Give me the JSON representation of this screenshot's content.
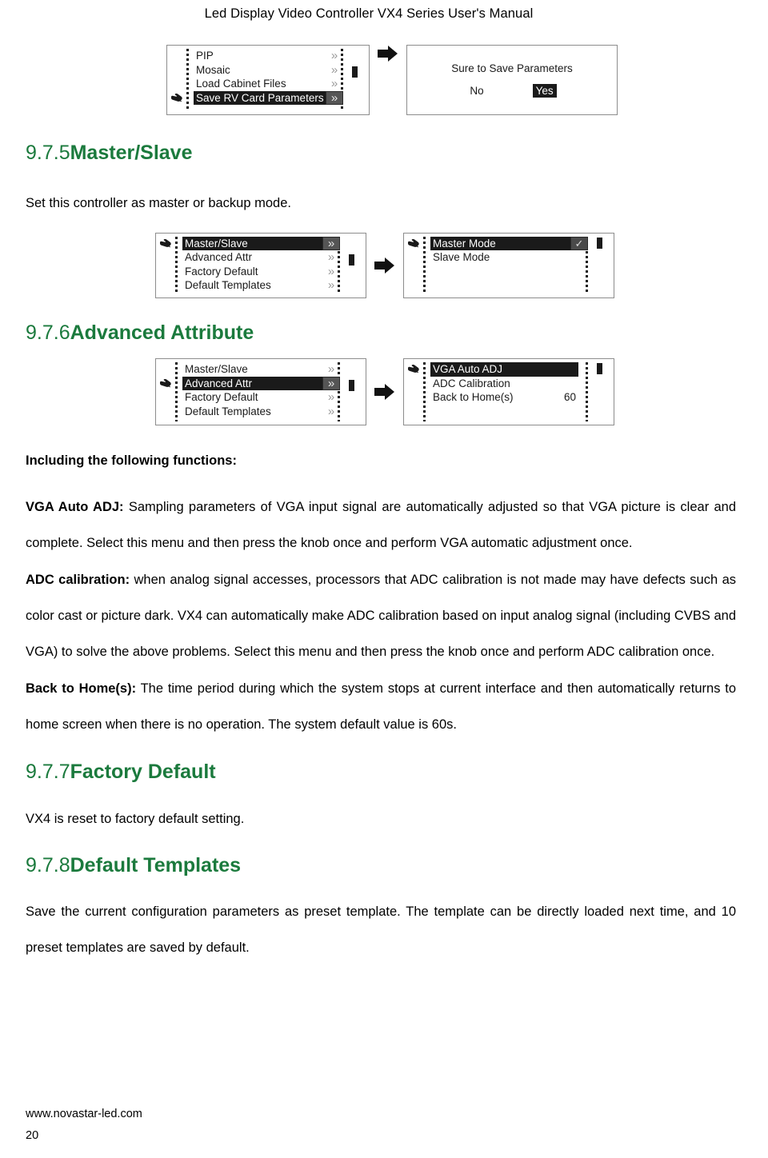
{
  "header": {
    "title": "Led Display Video Controller VX4 Series User's Manual"
  },
  "colors": {
    "heading_green": "#1b7a3d",
    "lcd_border": "#8d8d8d",
    "selected_bg": "#1a1a1a",
    "chevron_gray": "#9a9a9a"
  },
  "icons": {
    "hand": "pointing-hand-icon",
    "arrow": "right-arrow-icon",
    "chevron": "»",
    "check": "✓"
  },
  "diagrams": [
    {
      "name": "save-rv-card-parameters",
      "left_panel": {
        "rows": [
          {
            "label": "PIP",
            "chevron": "»",
            "selected": false,
            "hand": false,
            "value": ""
          },
          {
            "label": "Mosaic",
            "chevron": "»",
            "selected": false,
            "hand": false,
            "value": ""
          },
          {
            "label": "Load Cabinet Files",
            "chevron": "»",
            "selected": false,
            "hand": false,
            "value": ""
          },
          {
            "label": "Save RV Card Parameters",
            "chevron": "»",
            "selected": true,
            "hand": true,
            "value": ""
          }
        ]
      },
      "right_panel": {
        "type": "dialog",
        "message": "Sure to Save Parameters",
        "options": [
          {
            "label": "No",
            "selected": false
          },
          {
            "label": "Yes",
            "selected": true
          }
        ]
      }
    },
    {
      "name": "master-slave",
      "left_panel": {
        "rows": [
          {
            "label": "Master/Slave",
            "chevron": "»",
            "selected": true,
            "hand": true,
            "value": ""
          },
          {
            "label": "Advanced Attr",
            "chevron": "»",
            "selected": false,
            "hand": false,
            "value": ""
          },
          {
            "label": "Factory Default",
            "chevron": "»",
            "selected": false,
            "hand": false,
            "value": ""
          },
          {
            "label": "Default Templates",
            "chevron": "»",
            "selected": false,
            "hand": false,
            "value": ""
          }
        ]
      },
      "right_panel": {
        "type": "menu",
        "rows": [
          {
            "label": "Master Mode",
            "chevron": "✓",
            "selected": true,
            "hand": true,
            "value": ""
          },
          {
            "label": "Slave Mode",
            "chevron": "",
            "selected": false,
            "hand": false,
            "value": ""
          }
        ]
      }
    },
    {
      "name": "advanced-attribute",
      "left_panel": {
        "rows": [
          {
            "label": "Master/Slave",
            "chevron": "»",
            "selected": false,
            "hand": false,
            "value": ""
          },
          {
            "label": "Advanced Attr",
            "chevron": "»",
            "selected": true,
            "hand": true,
            "value": ""
          },
          {
            "label": "Factory Default",
            "chevron": "»",
            "selected": false,
            "hand": false,
            "value": ""
          },
          {
            "label": "Default Templates",
            "chevron": "»",
            "selected": false,
            "hand": false,
            "value": ""
          }
        ]
      },
      "right_panel": {
        "type": "menu",
        "rows": [
          {
            "label": "VGA Auto ADJ",
            "chevron": "",
            "selected": true,
            "hand": true,
            "value": ""
          },
          {
            "label": "ADC Calibration",
            "chevron": "",
            "selected": false,
            "hand": false,
            "value": ""
          },
          {
            "label": "Back to Home(s)",
            "chevron": "",
            "selected": false,
            "hand": false,
            "value": "60"
          }
        ]
      }
    }
  ],
  "sections": {
    "master_slave": {
      "number": "9.7.5",
      "title": "Master/Slave",
      "body": "Set this controller as master or backup mode."
    },
    "advanced_attribute": {
      "number": "9.7.6",
      "title": "Advanced Attribute",
      "intro": "Including the following functions:",
      "items": [
        {
          "term": "VGA Auto ADJ:",
          "text": " Sampling parameters of VGA input signal are automatically adjusted so that VGA picture is clear and complete. Select this menu and then press the knob once and perform VGA automatic adjustment once."
        },
        {
          "term": "ADC calibration:",
          "text": " when analog signal accesses, processors that ADC calibration is not made may have defects such as color cast or picture dark. VX4 can automatically make ADC calibration based on input analog signal (including CVBS and VGA) to solve the above problems. Select this menu and then press the knob once and perform ADC calibration once."
        },
        {
          "term": "Back to Home(s):",
          "text": " The time period during which the system stops at current interface and then automatically returns to home screen when there is no operation. The system default value is 60s."
        }
      ]
    },
    "factory_default": {
      "number": "9.7.7",
      "title": "Factory Default",
      "body": "VX4 is reset to factory default setting."
    },
    "default_templates": {
      "number": "9.7.8",
      "title": "Default Templates",
      "body": "Save the current configuration parameters as preset template. The template can be directly loaded next time, and 10 preset templates are saved by default."
    }
  },
  "footer": {
    "website": "www.novastar-led.com",
    "page_number": "20"
  }
}
